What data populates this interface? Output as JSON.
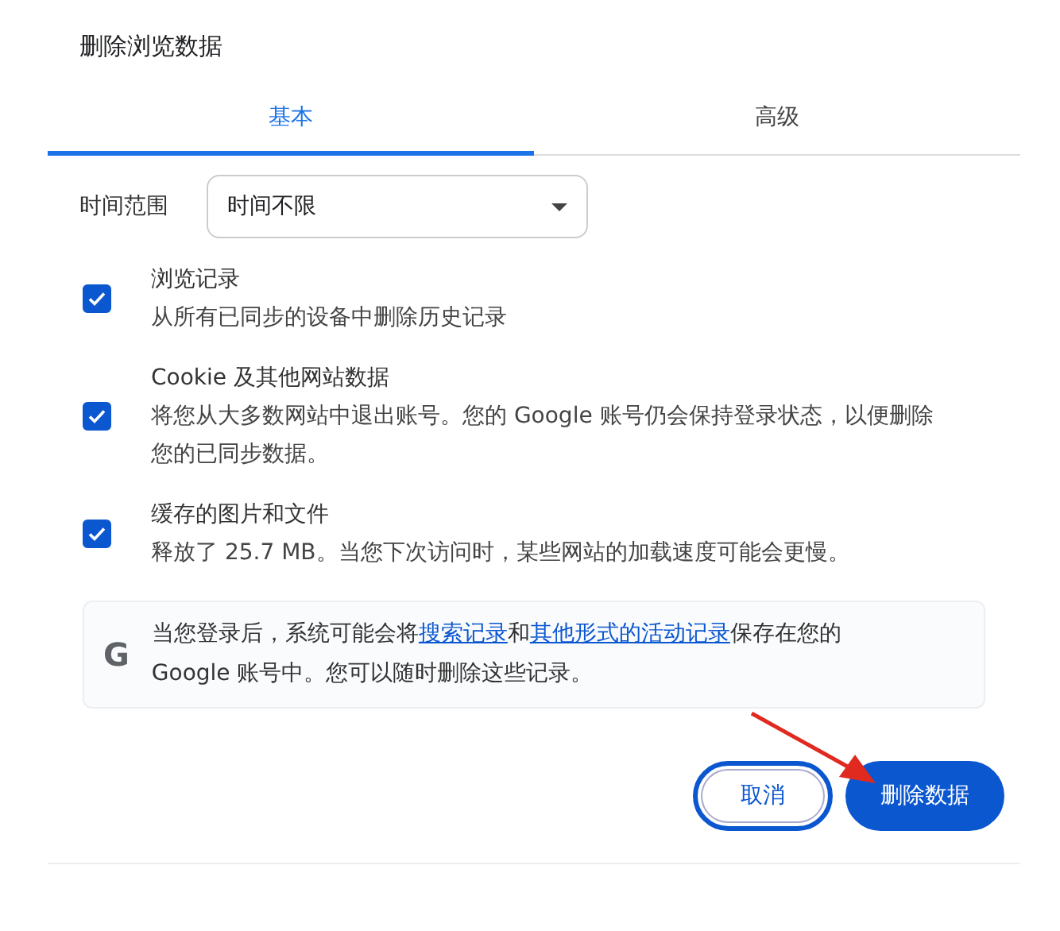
{
  "dialog": {
    "title": "删除浏览数据"
  },
  "tabs": [
    {
      "label": "基本",
      "selected": true
    },
    {
      "label": "高级",
      "selected": false
    }
  ],
  "time_range": {
    "label": "时间范围",
    "value": "时间不限"
  },
  "options": [
    {
      "title": "浏览记录",
      "description": "从所有已同步的设备中删除历史记录",
      "checked": true
    },
    {
      "title": "Cookie 及其他网站数据",
      "description": "将您从大多数网站中退出账号。您的 Google 账号仍会保持登录状态，以便删除您的已同步数据。",
      "checked": true
    },
    {
      "title": "缓存的图片和文件",
      "description": "释放了 25.7 MB。当您下次访问时，某些网站的加载速度可能会更慢。",
      "checked": true
    }
  ],
  "info": {
    "icon_text": "G",
    "parts": [
      {
        "kind": "text",
        "text": "当您登录后，系统可能会将"
      },
      {
        "kind": "link",
        "text": "搜索记录"
      },
      {
        "kind": "text",
        "text": "和"
      },
      {
        "kind": "link",
        "text": "其他形式的活动记录"
      },
      {
        "kind": "text",
        "text": "保存在您的 Google 账号中。您可以随时删除这些记录。"
      }
    ]
  },
  "buttons": [
    {
      "label": "取消",
      "kind": "secondary",
      "focused": true
    },
    {
      "label": "删除数据",
      "kind": "primary",
      "focused": false
    }
  ],
  "annotations": [
    {
      "kind": "arrow"
    }
  ]
}
